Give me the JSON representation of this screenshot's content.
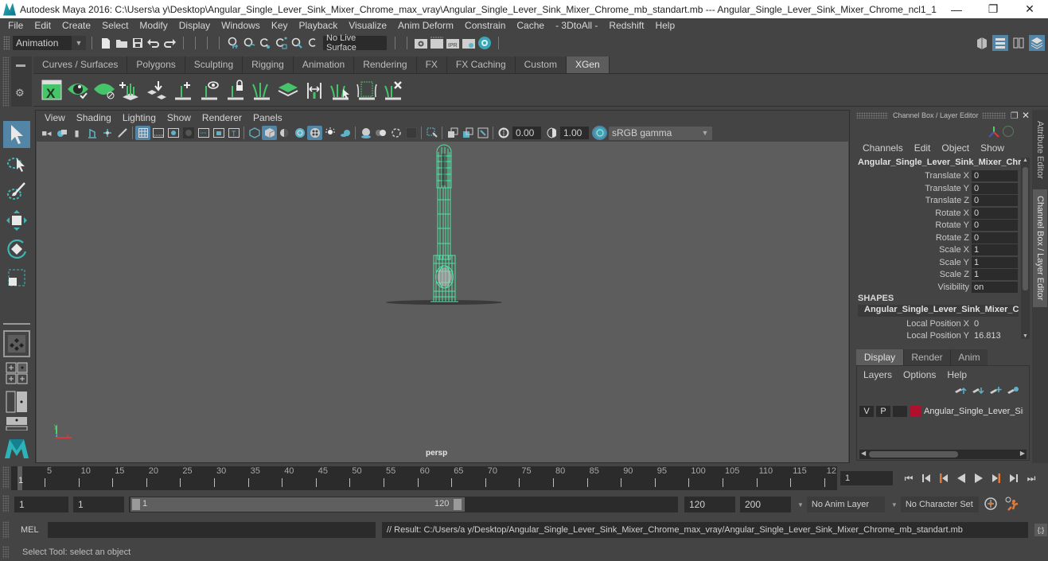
{
  "window": {
    "title": "Autodesk Maya 2016: C:\\Users\\a y\\Desktop\\Angular_Single_Lever_Sink_Mixer_Chrome_max_vray\\Angular_Single_Lever_Sink_Mixer_Chrome_mb_standart.mb   ---   Angular_Single_Lever_Sink_Mixer_Chrome_ncl1_1",
    "controls": {
      "minimize": "—",
      "restore": "❐",
      "close": "✕"
    }
  },
  "menubar": [
    "File",
    "Edit",
    "Create",
    "Select",
    "Modify",
    "Display",
    "Windows",
    "Key",
    "Playback",
    "Visualize",
    "Anim Deform",
    "Constrain",
    "Cache",
    "- 3DtoAll -",
    "Redshift",
    "Help"
  ],
  "statusline": {
    "menuset": "Animation",
    "live_surface": "No Live Surface",
    "icons": [
      "new-scene-icon",
      "open-scene-icon",
      "save-scene-icon",
      "undo-icon",
      "redo-icon",
      "snap-grid-icon",
      "snap-curve-icon",
      "snap-point-icon",
      "snap-view-plane-icon",
      "snap-live-icon",
      "snap-together-icon",
      "render-view-icon",
      "render-frame-icon",
      "ipr-render-icon",
      "render-settings-icon",
      "hypershade-icon"
    ]
  },
  "shelf": {
    "tabs": [
      "Curves / Surfaces",
      "Polygons",
      "Sculpting",
      "Rigging",
      "Animation",
      "Rendering",
      "FX",
      "FX Caching",
      "Custom",
      "XGen"
    ],
    "active_tab": "XGen",
    "icons": [
      "xgen-editor-icon",
      "xgen-preview-icon",
      "xgen-clear-preview-icon",
      "xgen-create-description-icon",
      "xgen-import-icon",
      "xgen-add-guide-icon",
      "xgen-show-guides-icon",
      "xgen-lock-guides-icon",
      "xgen-rebuild-guides-icon",
      "xgen-patch-icon",
      "xgen-guide-length-icon",
      "xgen-select-guides-icon",
      "xgen-guides-to-curves-icon",
      "xgen-delete-guide-icon"
    ]
  },
  "toolbox": {
    "tools": [
      "select-tool",
      "lasso-tool",
      "paint-select-tool",
      "move-tool",
      "rotate-tool",
      "scale-tool"
    ],
    "layouts": [
      "single-pane-layout",
      "four-pane-layout",
      "outliner-persp-layout",
      "persp-graph-layout"
    ]
  },
  "viewport": {
    "menus": [
      "View",
      "Shading",
      "Lighting",
      "Show",
      "Renderer",
      "Panels"
    ],
    "exposure": "0.00",
    "gamma": "1.00",
    "color_space": "sRGB gamma",
    "camera_label": "persp",
    "axis": {
      "y": "y",
      "z": "z",
      "x": "x"
    },
    "wireframe_color": "#4fe3a3"
  },
  "channel_box": {
    "title": "Channel Box / Layer Editor",
    "menus": [
      "Channels",
      "Edit",
      "Object",
      "Show"
    ],
    "object_name": "Angular_Single_Lever_Sink_Mixer_Chr...",
    "channels": [
      {
        "label": "Translate X",
        "value": "0"
      },
      {
        "label": "Translate Y",
        "value": "0"
      },
      {
        "label": "Translate Z",
        "value": "0"
      },
      {
        "label": "Rotate X",
        "value": "0"
      },
      {
        "label": "Rotate Y",
        "value": "0"
      },
      {
        "label": "Rotate Z",
        "value": "0"
      },
      {
        "label": "Scale X",
        "value": "1"
      },
      {
        "label": "Scale Y",
        "value": "1"
      },
      {
        "label": "Scale Z",
        "value": "1"
      },
      {
        "label": "Visibility",
        "value": "on"
      }
    ],
    "shapes_header": "SHAPES",
    "shape_name": "Angular_Single_Lever_Sink_Mixer_C...",
    "shape_channels": [
      {
        "label": "Local Position X",
        "value": "0"
      },
      {
        "label": "Local Position Y",
        "value": "16.813"
      }
    ]
  },
  "layer_editor": {
    "tabs": [
      "Display",
      "Render",
      "Anim"
    ],
    "active_tab": "Display",
    "menus": [
      "Layers",
      "Options",
      "Help"
    ],
    "layers": [
      {
        "visible": "V",
        "playback": "P",
        "name": "Angular_Single_Lever_Sir",
        "color": "#b0102e"
      }
    ]
  },
  "side_tabs": [
    "Attribute Editor",
    "Channel Box / Layer Editor"
  ],
  "timeline": {
    "ticks": [
      "5",
      "10",
      "15",
      "20",
      "25",
      "30",
      "35",
      "40",
      "45",
      "50",
      "55",
      "60",
      "65",
      "70",
      "75",
      "80",
      "85",
      "90",
      "95",
      "100",
      "105",
      "110",
      "115",
      "12"
    ],
    "current_marker": "1",
    "current_frame": "1",
    "playback_buttons": [
      "go-to-start",
      "step-back-frame",
      "step-back-key",
      "play-backwards",
      "play-forwards",
      "step-forward-key",
      "step-forward-frame",
      "go-to-end"
    ]
  },
  "range": {
    "start": "1",
    "playback_start": "1",
    "slider_start": "1",
    "slider_end": "120",
    "playback_end": "120",
    "end": "200",
    "anim_layer": "No Anim Layer",
    "character_set": "No Character Set"
  },
  "command_line": {
    "language": "MEL",
    "input": "",
    "result": "// Result: C:/Users/a y/Desktop/Angular_Single_Lever_Sink_Mixer_Chrome_max_vray/Angular_Single_Lever_Sink_Mixer_Chrome_mb_standart.mb"
  },
  "help_line": "Select Tool: select an object",
  "colors": {
    "accent": "#5285a6",
    "xgen_green": "#46c46a",
    "bg": "#444444",
    "viewport_bg": "#5d5d5d"
  }
}
